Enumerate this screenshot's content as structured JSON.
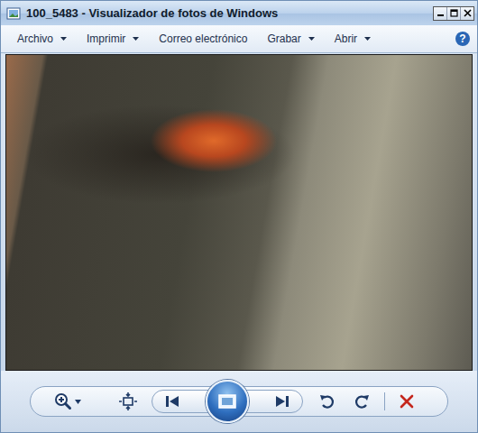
{
  "window": {
    "title": "100_5483 - Visualizador de fotos de Windows"
  },
  "menu": [
    {
      "label": "Archivo",
      "dropdown": true
    },
    {
      "label": "Imprimir",
      "dropdown": true
    },
    {
      "label": "Correo electrónico",
      "dropdown": false
    },
    {
      "label": "Grabar",
      "dropdown": true
    },
    {
      "label": "Abrir",
      "dropdown": true
    }
  ],
  "help": "?",
  "toolbar": [
    {
      "kind": "zoom",
      "dropdown": true
    },
    {
      "kind": "fit",
      "dropdown": false
    },
    {
      "kind": "previous",
      "dropdown": false
    },
    {
      "kind": "slideshow",
      "dropdown": false
    },
    {
      "kind": "next",
      "dropdown": false
    },
    {
      "kind": "rotate-left",
      "dropdown": false
    },
    {
      "kind": "rotate-right",
      "dropdown": false
    },
    {
      "kind": "delete",
      "dropdown": false
    }
  ]
}
